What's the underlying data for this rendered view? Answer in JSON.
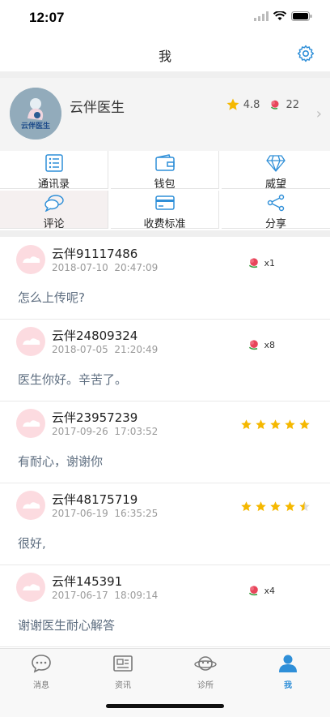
{
  "status": {
    "time": "12:07"
  },
  "nav": {
    "title": "我"
  },
  "profile": {
    "avatar_text": "云伴医生",
    "name": "云伴医生",
    "rating": "4.8",
    "flowers": "22"
  },
  "grid": [
    {
      "label": "通讯录",
      "icon": "contacts-icon"
    },
    {
      "label": "钱包",
      "icon": "wallet-icon"
    },
    {
      "label": "威望",
      "icon": "diamond-icon"
    },
    {
      "label": "评论",
      "icon": "comment-icon"
    },
    {
      "label": "收费标准",
      "icon": "card-icon"
    },
    {
      "label": "分享",
      "icon": "share-icon"
    }
  ],
  "reviews": [
    {
      "name": "云伴91117486",
      "date": "2018-07-10",
      "time": "20:47:09",
      "message": "怎么上传呢?",
      "flowers": "x1",
      "stars": null
    },
    {
      "name": "云伴24809324",
      "date": "2018-07-05",
      "time": "21:20:49",
      "message": "医生你好。辛苦了。",
      "flowers": "x8",
      "stars": null
    },
    {
      "name": "云伴23957239",
      "date": "2017-09-26",
      "time": "17:03:52",
      "message": "有耐心，谢谢你",
      "flowers": null,
      "stars": 5
    },
    {
      "name": "云伴48175719",
      "date": "2017-06-19",
      "time": "16:35:25",
      "message": "很好,",
      "flowers": null,
      "stars": 4.5
    },
    {
      "name": "云伴145391",
      "date": "2017-06-17",
      "time": "18:09:14",
      "message": "谢谢医生耐心解答",
      "flowers": "x4",
      "stars": null
    }
  ],
  "tabs": [
    {
      "label": "消息",
      "icon": "message-icon"
    },
    {
      "label": "资讯",
      "icon": "news-icon"
    },
    {
      "label": "诊所",
      "icon": "clinic-icon"
    },
    {
      "label": "我",
      "icon": "profile-icon"
    }
  ],
  "colors": {
    "accent": "#2f8fd8",
    "star": "#f5b800",
    "flower": "#e8455a"
  }
}
